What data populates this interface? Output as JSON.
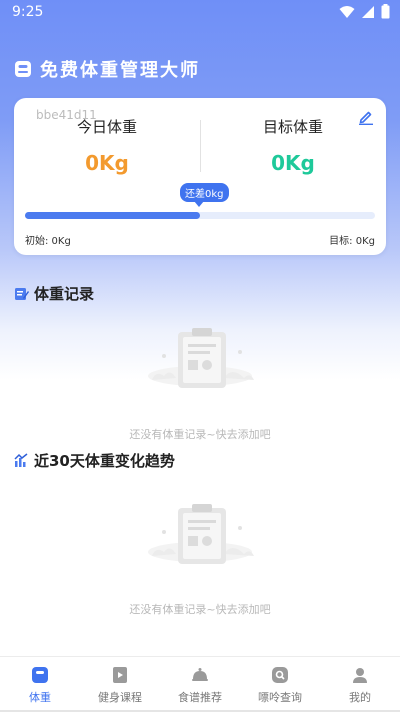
{
  "status_bar": {
    "time": "9:25"
  },
  "app": {
    "title": "免费体重管理大师"
  },
  "card": {
    "watermark": "bbe41d11",
    "today_label": "今日体重",
    "today_value": "0Kg",
    "target_label": "目标体重",
    "target_value": "0Kg",
    "tooltip": "还差0kg",
    "progress_fraction": 0.5,
    "start_label": "初始: 0Kg",
    "target_end_label": "目标: 0Kg",
    "colors": {
      "today": "#f39a2e",
      "target": "#1ec99a",
      "accent": "#3f73ef"
    }
  },
  "weight_record": {
    "title": "体重记录",
    "empty_text": "还没有体重记录~快去添加吧"
  },
  "trend": {
    "title": "近30天体重变化趋势",
    "empty_text": "还没有体重记录~快去添加吧"
  },
  "bottom_nav": [
    {
      "label": "体重",
      "icon": "scale-icon",
      "active": true
    },
    {
      "label": "健身课程",
      "icon": "course-icon",
      "active": false
    },
    {
      "label": "食谱推荐",
      "icon": "food-cloche-icon",
      "active": false
    },
    {
      "label": "嘌呤查询",
      "icon": "search-app-icon",
      "active": false
    },
    {
      "label": "我的",
      "icon": "profile-icon",
      "active": false
    }
  ]
}
